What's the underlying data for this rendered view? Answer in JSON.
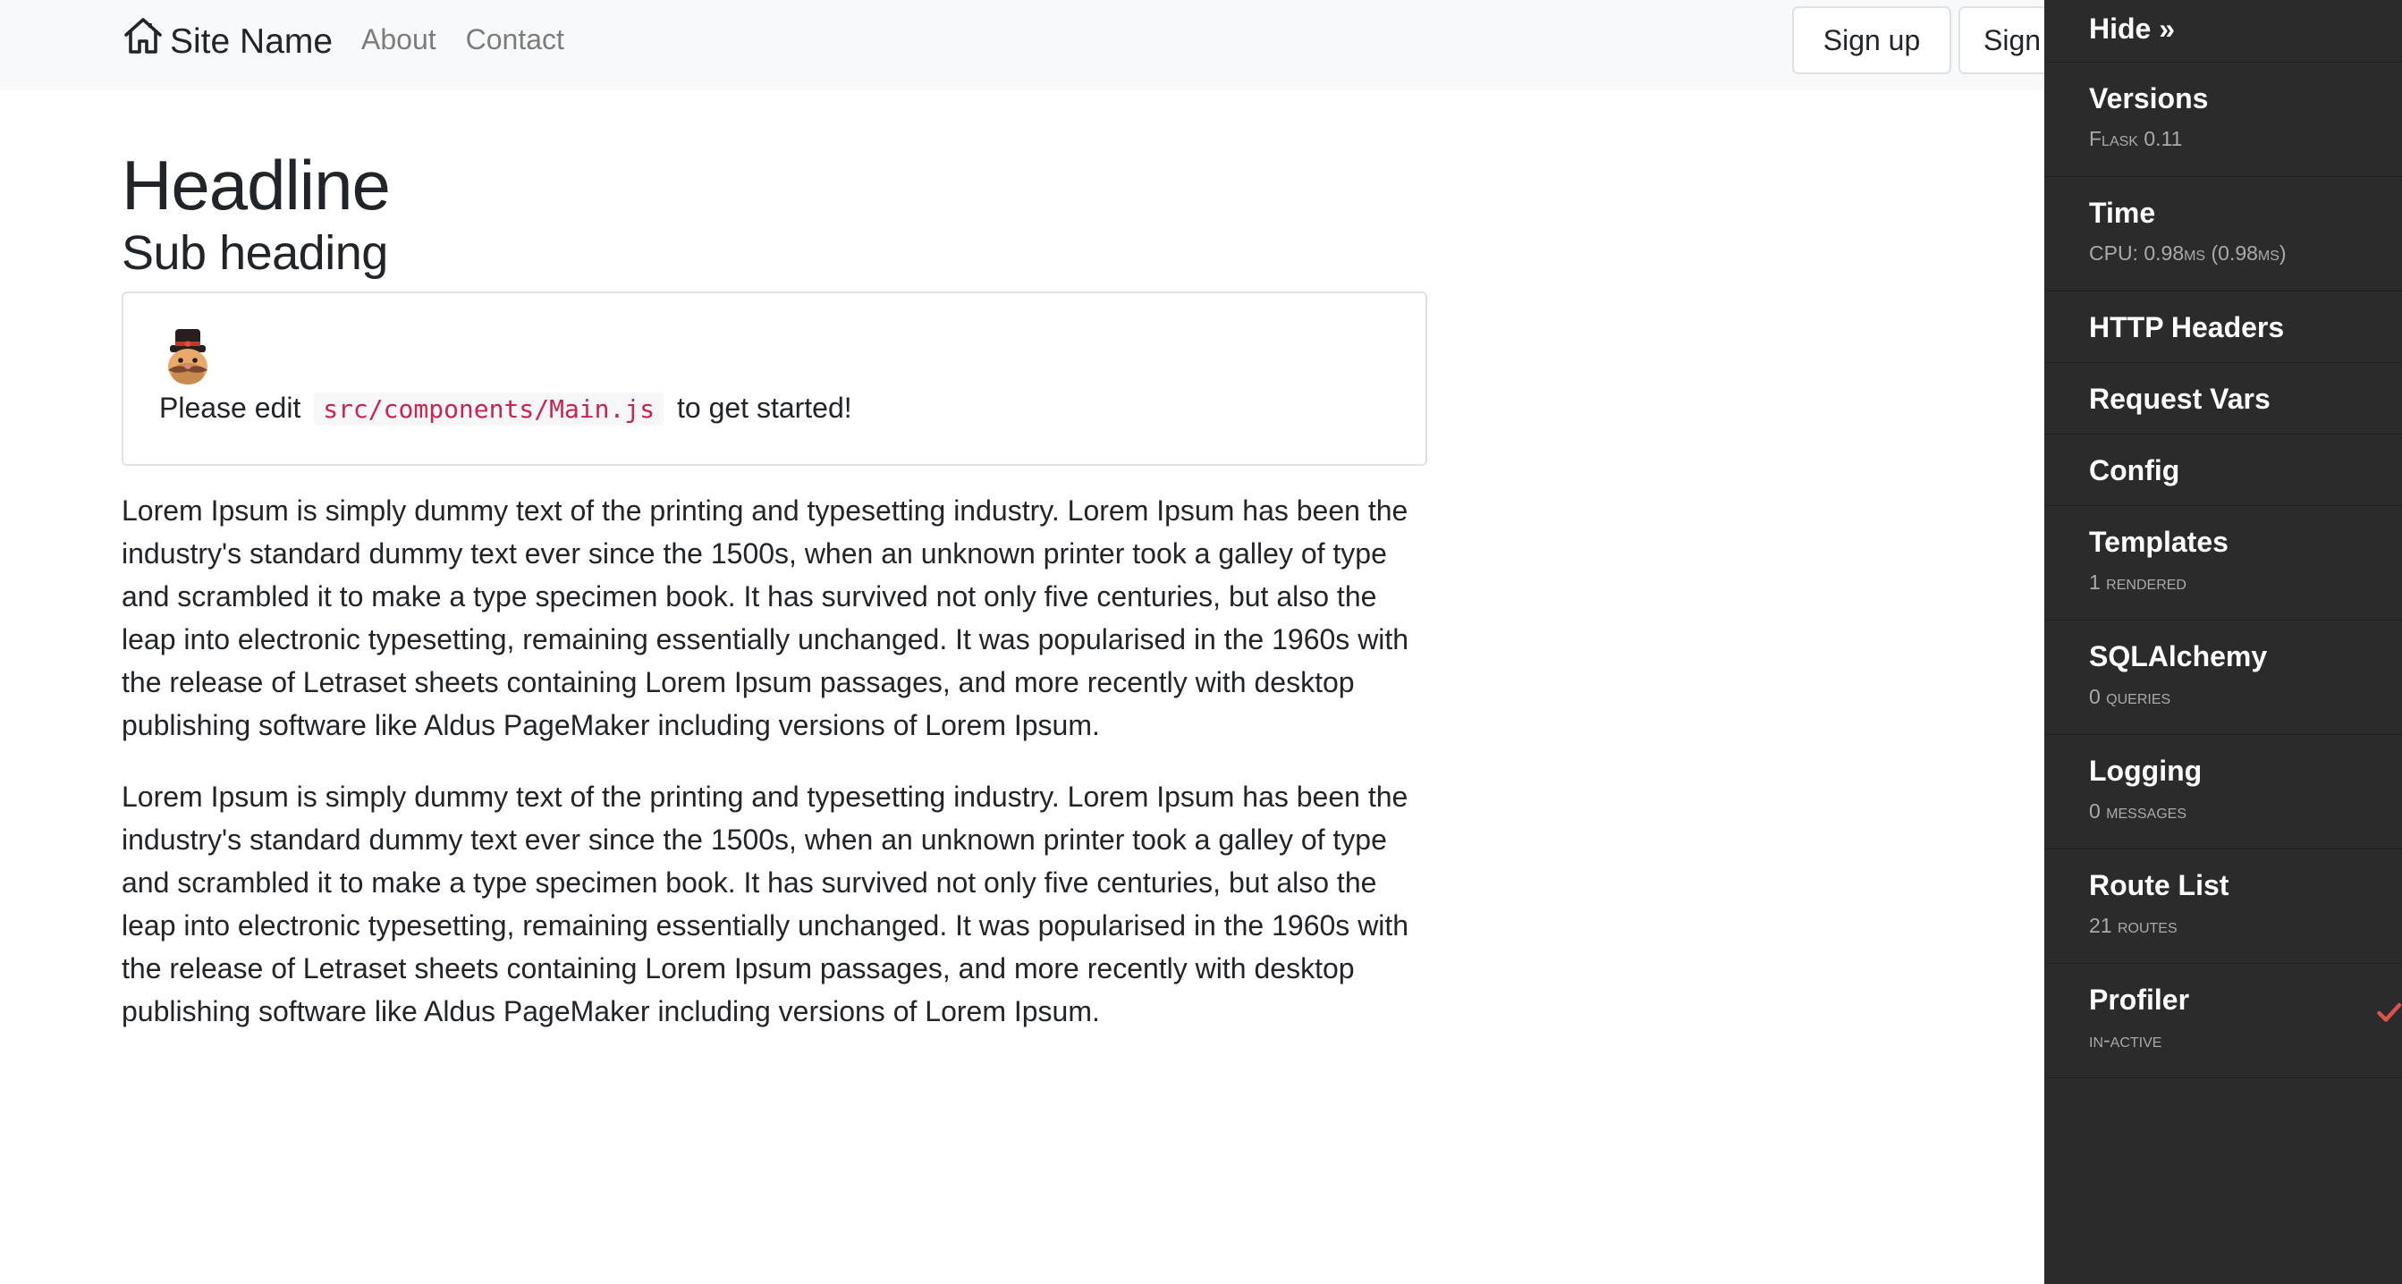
{
  "navbar": {
    "brand": "Site Name",
    "links": [
      "About",
      "Contact"
    ],
    "signup_label": "Sign up",
    "signin_label": "Sign in"
  },
  "main": {
    "headline": "Headline",
    "subheading": "Sub heading",
    "callout": {
      "before": "Please edit",
      "code": "src/components/Main.js",
      "after": "to get started!"
    },
    "paragraphs": [
      "Lorem Ipsum is simply dummy text of the printing and typesetting industry. Lorem Ipsum has been the industry's standard dummy text ever since the 1500s, when an unknown printer took a galley of type and scrambled it to make a type specimen book. It has survived not only five centuries, but also the leap into electronic typesetting, remaining essentially unchanged. It was popularised in the 1960s with the release of Letraset sheets containing Lorem Ipsum passages, and more recently with desktop publishing software like Aldus PageMaker including versions of Lorem Ipsum.",
      "Lorem Ipsum is simply dummy text of the printing and typesetting industry. Lorem Ipsum has been the industry's standard dummy text ever since the 1500s, when an unknown printer took a galley of type and scrambled it to make a type specimen book. It has survived not only five centuries, but also the leap into electronic typesetting, remaining essentially unchanged. It was popularised in the 1960s with the release of Letraset sheets containing Lorem Ipsum passages, and more recently with desktop publishing software like Aldus PageMaker including versions of Lorem Ipsum."
    ]
  },
  "toolbar": {
    "hide_label": "Hide »",
    "panels": [
      {
        "title": "Versions",
        "subtitle": "Flask 0.11"
      },
      {
        "title": "Time",
        "subtitle": "CPU: 0.98ms (0.98ms)"
      },
      {
        "title": "HTTP Headers",
        "subtitle": ""
      },
      {
        "title": "Request Vars",
        "subtitle": ""
      },
      {
        "title": "Config",
        "subtitle": ""
      },
      {
        "title": "Templates",
        "subtitle": "1 rendered"
      },
      {
        "title": "SQLAlchemy",
        "subtitle": "0 queries"
      },
      {
        "title": "Logging",
        "subtitle": "0 messages"
      },
      {
        "title": "Route List",
        "subtitle": "21 routes"
      },
      {
        "title": "Profiler",
        "subtitle": "in-active"
      }
    ]
  },
  "colors": {
    "navbar_bg": "#f8f9fa",
    "toolbar_bg": "#2b2b2b",
    "code_color": "#c7254e",
    "check_color": "#d9534f"
  }
}
